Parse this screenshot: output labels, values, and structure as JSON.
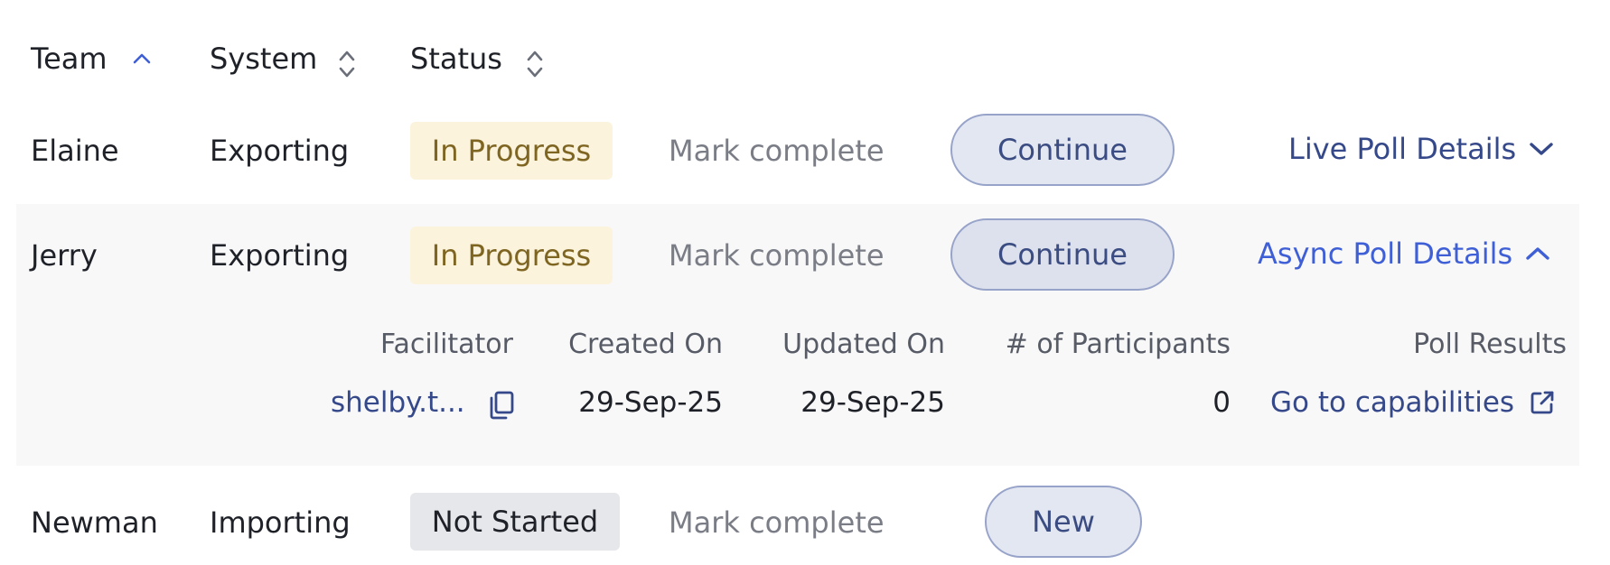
{
  "columns": {
    "team": "Team",
    "system": "System",
    "status": "Status"
  },
  "rows": [
    {
      "team": "Elaine",
      "system": "Exporting",
      "status": "In Progress",
      "mark_complete": "Mark complete",
      "action": "Continue",
      "details": "Live Poll Details"
    },
    {
      "team": "Jerry",
      "system": "Exporting",
      "status": "In Progress",
      "mark_complete": "Mark complete",
      "action": "Continue",
      "details": "Async Poll Details"
    },
    {
      "team": "Newman",
      "system": "Importing",
      "status": "Not Started",
      "mark_complete": "Mark complete",
      "action": "New"
    }
  ],
  "expanded": {
    "headers": {
      "facilitator": "Facilitator",
      "created_on": "Created On",
      "updated_on": "Updated On",
      "participants": "# of Participants",
      "poll_results": "Poll Results"
    },
    "values": {
      "facilitator": "shelby.t...",
      "created_on": "29-Sep-25",
      "updated_on": "29-Sep-25",
      "participants": "0",
      "poll_results": "Go to capabilities"
    }
  },
  "colors": {
    "link_live": "#35498a",
    "link_async": "#3f5fd6",
    "sort_active": "#3f5fd6",
    "sort_inactive": "#6b6f7a",
    "badge_progress_bg": "#fbf3dc",
    "badge_notstarted_bg": "#e6e7ea"
  },
  "icons": {
    "team_sort": "chevron-up-icon",
    "system_sort": "sort-icon",
    "status_sort": "sort-icon",
    "live_details": "chevron-down-icon",
    "async_details": "chevron-up-icon",
    "copy": "copy-icon",
    "external": "external-link-icon"
  }
}
